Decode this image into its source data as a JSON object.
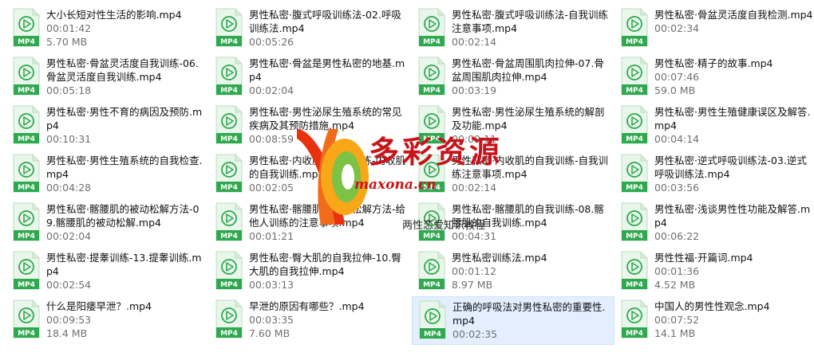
{
  "files": [
    {
      "name": "大小长短对性生活的影响.mp4",
      "sub1": "00:01:42",
      "sub2": "5.70 MB"
    },
    {
      "name": "男性私密·腹式呼吸训练法-02.呼吸训练法.mp4",
      "sub1": "00:05:26",
      "sub2": ""
    },
    {
      "name": "男性私密·腹式呼吸训练法-自我训练注意事项.mp4",
      "sub1": "00:02:14",
      "sub2": ""
    },
    {
      "name": "男性私密·骨盆灵活度自我检测.mp4",
      "sub1": "00:02:34",
      "sub2": ""
    },
    {
      "name": "男性私密·骨盆灵活度自我训练-06.骨盆灵活度自我训练.mp4",
      "sub1": "00:05:18",
      "sub2": ""
    },
    {
      "name": "男性私密·骨盆是男性私密的地基.mp4",
      "sub1": "00:02:04",
      "sub2": ""
    },
    {
      "name": "男性私密·骨盆周围肌肉拉伸-07.骨盆周围肌肉拉伸.mp4",
      "sub1": "00:03:19",
      "sub2": ""
    },
    {
      "name": "男性私密·精子的故事.mp4",
      "sub1": "00:07:46",
      "sub2": "59.0 MB"
    },
    {
      "name": "男性私密·男性不育的病因及预防.mp4",
      "sub1": "00:10:31",
      "sub2": ""
    },
    {
      "name": "男性私密·男性泌尿生殖系统的常见疾病及其预防措施.mp4",
      "sub1": "00:08:59",
      "sub2": ""
    },
    {
      "name": "男性私密·男性泌尿生殖系统的解剖及功能.mp4",
      "sub1": "00:09:11",
      "sub2": ""
    },
    {
      "name": "男性私密·男性生殖健康误区及解答.mp4",
      "sub1": "00:04:14",
      "sub2": ""
    },
    {
      "name": "男性私密·男性生殖系统的自我检查.mp4",
      "sub1": "00:04:28",
      "sub2": ""
    },
    {
      "name": "男性私密·内收肌的自我训练-内收肌的自我训练.mp4",
      "sub1": "00:02:05",
      "sub2": ""
    },
    {
      "name": "男性私密·内收肌的自我训练-自我训练注意事项.mp4",
      "sub1": "00:02:14",
      "sub2": ""
    },
    {
      "name": "男性私密·逆式呼吸训练法-03.逆式呼吸训练法.mp4",
      "sub1": "00:03:56",
      "sub2": ""
    },
    {
      "name": "男性私密·髂腰肌的被动松解方法-09.髂腰肌的被动松解.mp4",
      "sub1": "00:02:04",
      "sub2": ""
    },
    {
      "name": "男性私密·髂腰肌的被动松解方法-给他人训练的注意事项.mp4",
      "sub1": "00:01:21",
      "sub2": ""
    },
    {
      "name": "男性私密·髂腰肌的自我训练-08.髂腰肌的自我训练.mp4",
      "sub1": "00:04:31",
      "sub2": ""
    },
    {
      "name": "男性私密·浅谈男性性功能及解答.mp4",
      "sub1": "00:06:22",
      "sub2": ""
    },
    {
      "name": "男性私密·提睾训练-13.提睾训练.mp4",
      "sub1": "00:02:54",
      "sub2": ""
    },
    {
      "name": "男性私密·臀大肌的自我拉伸-10.臀大肌的自我拉伸.mp4",
      "sub1": "00:03:13",
      "sub2": ""
    },
    {
      "name": "男性私密训练法.mp4",
      "sub1": "00:01:12",
      "sub2": "8.97 MB"
    },
    {
      "name": "男性性福·开篇词.mp4",
      "sub1": "00:01:36",
      "sub2": "4.52 MB"
    },
    {
      "name": "什么是阳痿早泄？.mp4",
      "sub1": "00:09:53",
      "sub2": "18.4 MB"
    },
    {
      "name": "早泄的原因有哪些？.mp4",
      "sub1": "00:03:35",
      "sub2": "7.60 MB"
    },
    {
      "name": "正确的呼吸法对男性私密的重要性.mp4",
      "sub1": "00:02:35",
      "sub2": "",
      "selected": true
    },
    {
      "name": "中国人的男性性观念.mp4",
      "sub1": "00:07:52",
      "sub2": "14.1 MB"
    }
  ],
  "icon": {
    "label": "MP4",
    "green": "#2fa84f",
    "light": "#e9f6ea"
  },
  "watermark": {
    "big": "多彩资源",
    "url": "maxona.cn",
    "sub": "两性恋爱知识教程"
  }
}
